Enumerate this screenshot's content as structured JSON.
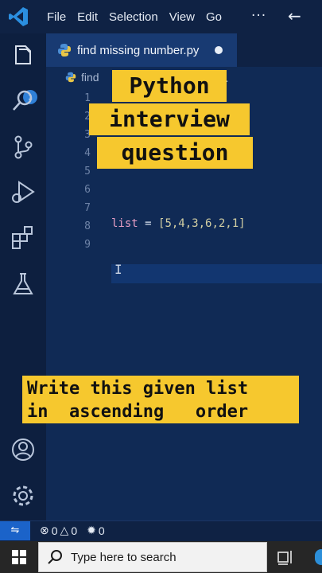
{
  "menu": {
    "items": [
      "File",
      "Edit",
      "Selection",
      "View",
      "Go"
    ],
    "overflow": "···",
    "back_icon": "arrow-left-icon"
  },
  "activity_bar": {
    "icons": [
      "explorer-icon",
      "search-icon",
      "source-control-icon",
      "run-debug-icon",
      "extensions-icon",
      "testing-icon",
      "account-icon",
      "settings-gear-icon"
    ],
    "explorer_badge": "1"
  },
  "editor": {
    "tab": {
      "label": "find missing number.py",
      "modified": true
    },
    "breadcrumb": {
      "label": "find",
      "overflow": "..."
    },
    "line_numbers": [
      "1",
      "2",
      "3",
      "4",
      "5",
      "6",
      "7",
      "8",
      "9"
    ],
    "code": {
      "line8": {
        "keyword": "list",
        "operator": " = ",
        "value": "[5,4,3,6,2,1]"
      }
    }
  },
  "overlays": {
    "title_lines": [
      "Python",
      "interview",
      "question"
    ],
    "caption_lines": [
      "Write this given list",
      "in  ascending   order"
    ]
  },
  "status_bar": {
    "errors": "0",
    "warnings": "0",
    "ports": "0"
  },
  "taskbar": {
    "search_placeholder": "Type here to search"
  },
  "colors": {
    "overlay_yellow": "#f6c82e",
    "editor_bg": "#102a55",
    "accent_blue": "#1b63c9"
  }
}
